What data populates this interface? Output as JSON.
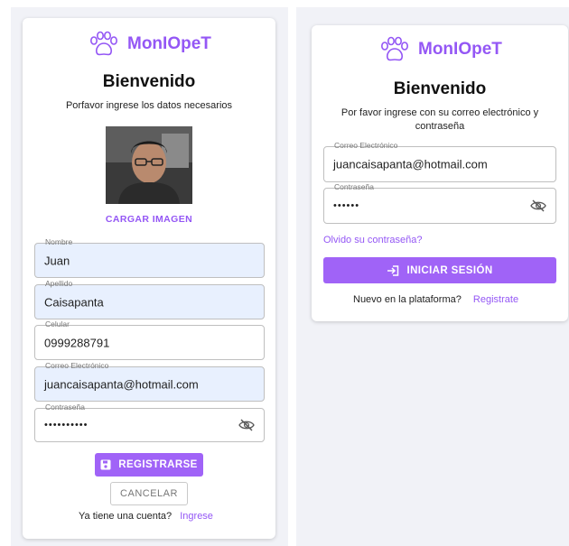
{
  "brand": {
    "name": "MonIOpeT",
    "accent": "#9457f5"
  },
  "register": {
    "title": "Bienvenido",
    "subtitle": "Porfavor ingrese los datos necesarios",
    "upload_label": "CARGAR IMAGEN",
    "fields": {
      "nombre": {
        "label": "Nombre",
        "value": "Juan"
      },
      "apellido": {
        "label": "Apellido",
        "value": "Caisapanta"
      },
      "celular": {
        "label": "Celular",
        "value": "0999288791"
      },
      "correo": {
        "label": "Correo Electrónico",
        "value": "juancaisapanta@hotmail.com"
      },
      "contrasena": {
        "label": "Contraseña",
        "value": "••••••••••"
      }
    },
    "register_button": "REGISTRARSE",
    "cancel_button": "CANCELAR",
    "footer_text": "Ya tiene una cuenta?",
    "footer_link": "Ingrese"
  },
  "login": {
    "title": "Bienvenido",
    "subtitle": "Por favor ingrese con su correo electrónico y contraseña",
    "fields": {
      "correo": {
        "label": "Correo Electrónico",
        "value": "juancaisapanta@hotmail.com"
      },
      "contrasena": {
        "label": "Contraseña",
        "value": "••••••"
      }
    },
    "forgot_link": "Olvido su contraseña?",
    "login_button": "INICIAR SESIÓN",
    "footer_text": "Nuevo en la plataforma?",
    "footer_link": "Registrate"
  }
}
